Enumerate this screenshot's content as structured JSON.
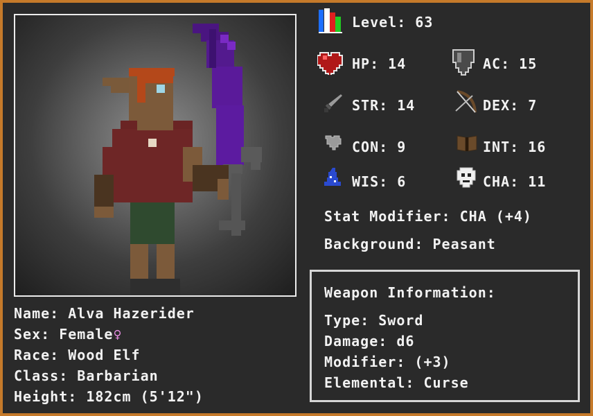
{
  "character": {
    "name_label": "Name:",
    "name": "Alva Hazerider",
    "sex_label": "Sex:",
    "sex": "Female",
    "sex_symbol": "♀",
    "race_label": "Race:",
    "race": "Wood Elf",
    "class_label": "Class:",
    "class": "Barbarian",
    "height_label": "Height:",
    "height": "182cm (5'12\")"
  },
  "level": {
    "label": "Level:",
    "value": "63"
  },
  "stats": {
    "hp": {
      "label": "HP:",
      "value": "14",
      "icon": "heart-icon"
    },
    "ac": {
      "label": "AC:",
      "value": "15",
      "icon": "shield-icon"
    },
    "str": {
      "label": "STR:",
      "value": "14",
      "icon": "dagger-icon"
    },
    "dex": {
      "label": "DEX:",
      "value": "7",
      "icon": "bow-icon"
    },
    "con": {
      "label": "CON:",
      "value": "9",
      "icon": "grey-heart-icon"
    },
    "int": {
      "label": "INT:",
      "value": "16",
      "icon": "book-icon"
    },
    "wis": {
      "label": "WIS:",
      "value": "6",
      "icon": "wizard-hat-icon"
    },
    "cha": {
      "label": "CHA:",
      "value": "11",
      "icon": "mask-icon"
    }
  },
  "stat_modifier": {
    "label": "Stat Modifier:",
    "value": "CHA (+4)"
  },
  "background": {
    "label": "Background:",
    "value": "Peasant"
  },
  "weapon": {
    "title": "Weapon Information:",
    "type_label": "Type:",
    "type": "Sword",
    "damage_label": "Damage:",
    "damage": "d6",
    "modifier_label": "Modifier:",
    "modifier": "(+3)",
    "elemental_label": "Elemental:",
    "elemental": "Curse"
  },
  "colors": {
    "frame": "#c57a2a",
    "background": "#2a2a2a",
    "text": "#f2f2f2",
    "sword": "#5a1a9a",
    "female_symbol": "#e58ce0"
  }
}
